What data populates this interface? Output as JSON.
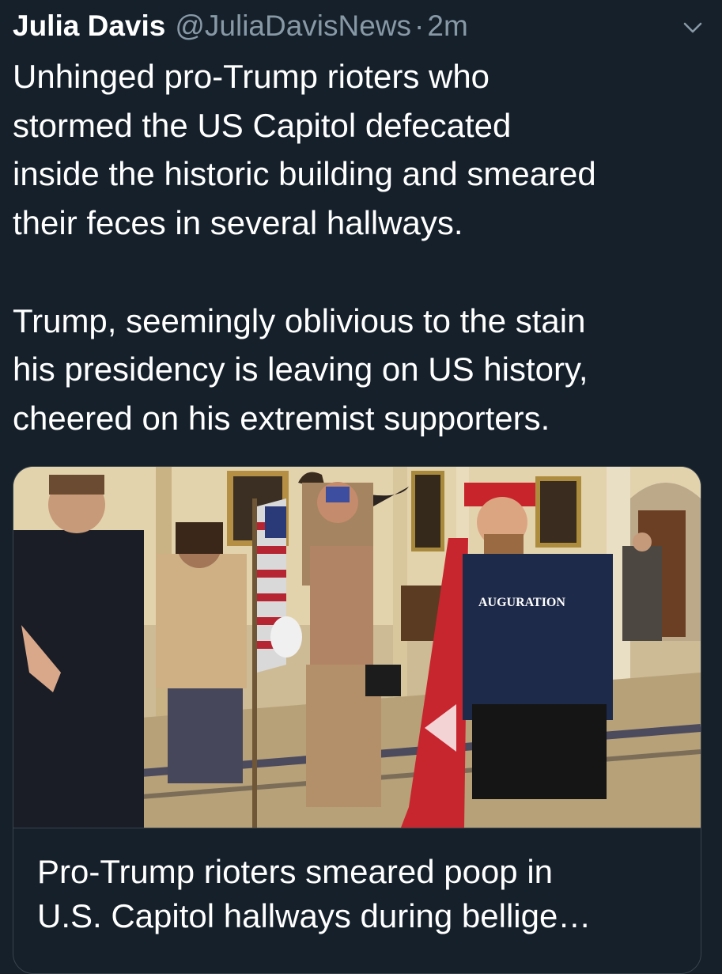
{
  "tweet": {
    "author_name": "Julia Davis",
    "author_handle": "@JuliaDavisNews",
    "separator": "·",
    "timestamp": "2m",
    "text": "Unhinged pro-Trump rioters who\nstormed the US Capitol defecated\ninside the historic building and smeared\ntheir feces in several hallways.\n\nTrump, seemingly oblivious to the stain\nhis presidency is leaving on US history,\ncheered on his extremist supporters.",
    "menu_icon": "chevron-down-icon"
  },
  "card": {
    "title": "Pro-Trump rioters smeared poop in\nU.S. Capitol hallways during bellige…",
    "image_sign_text": "AUGURATION"
  },
  "colors": {
    "background": "#15202b",
    "text_primary": "#ffffff",
    "text_secondary": "#8899a6",
    "border": "#38444d"
  }
}
